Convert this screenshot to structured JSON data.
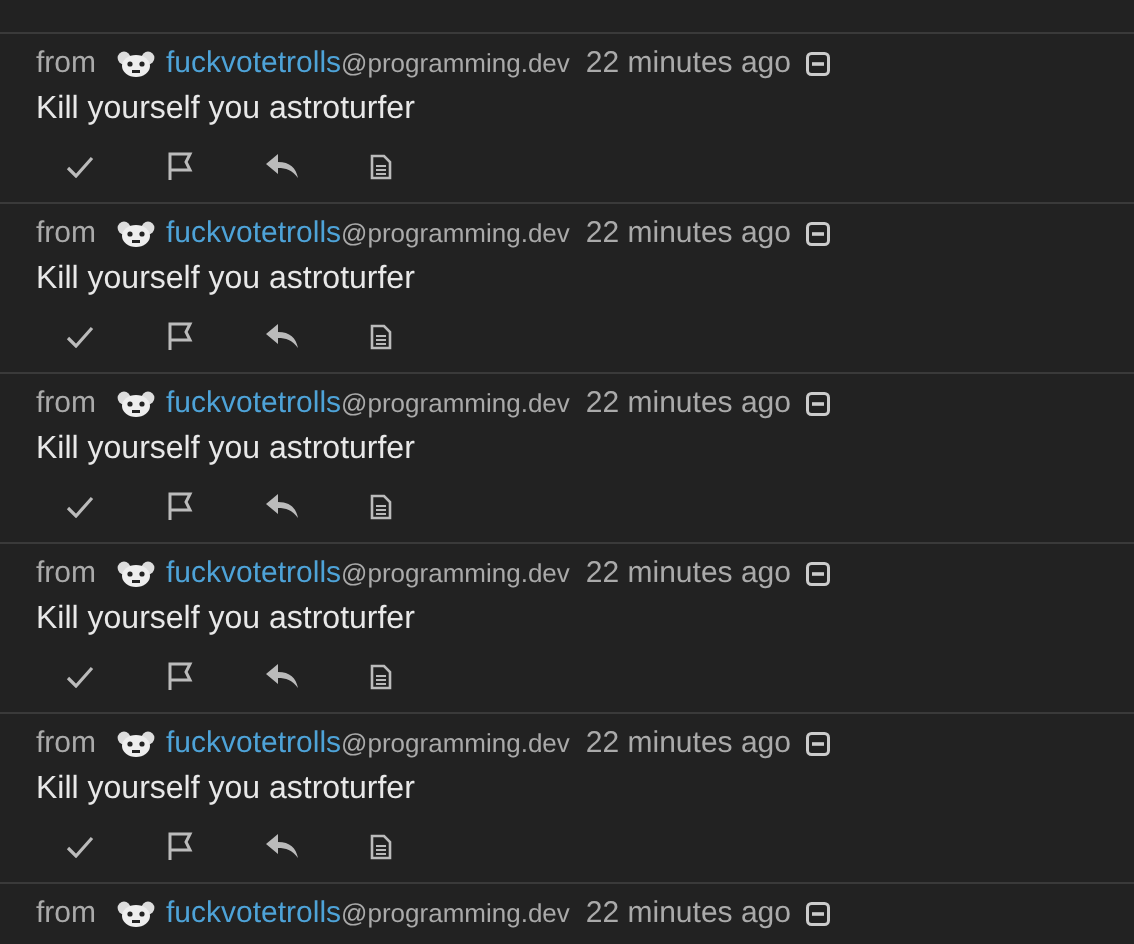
{
  "messages": [
    {
      "from": "from",
      "username": "fuckvotetrolls",
      "instance": "@programming.dev",
      "time": "22 minutes ago",
      "body": "Kill yourself you astroturfer"
    },
    {
      "from": "from",
      "username": "fuckvotetrolls",
      "instance": "@programming.dev",
      "time": "22 minutes ago",
      "body": "Kill yourself you astroturfer"
    },
    {
      "from": "from",
      "username": "fuckvotetrolls",
      "instance": "@programming.dev",
      "time": "22 minutes ago",
      "body": "Kill yourself you astroturfer"
    },
    {
      "from": "from",
      "username": "fuckvotetrolls",
      "instance": "@programming.dev",
      "time": "22 minutes ago",
      "body": "Kill yourself you astroturfer"
    },
    {
      "from": "from",
      "username": "fuckvotetrolls",
      "instance": "@programming.dev",
      "time": "22 minutes ago",
      "body": "Kill yourself you astroturfer"
    },
    {
      "from": "from",
      "username": "fuckvotetrolls",
      "instance": "@programming.dev",
      "time": "22 minutes ago"
    }
  ]
}
